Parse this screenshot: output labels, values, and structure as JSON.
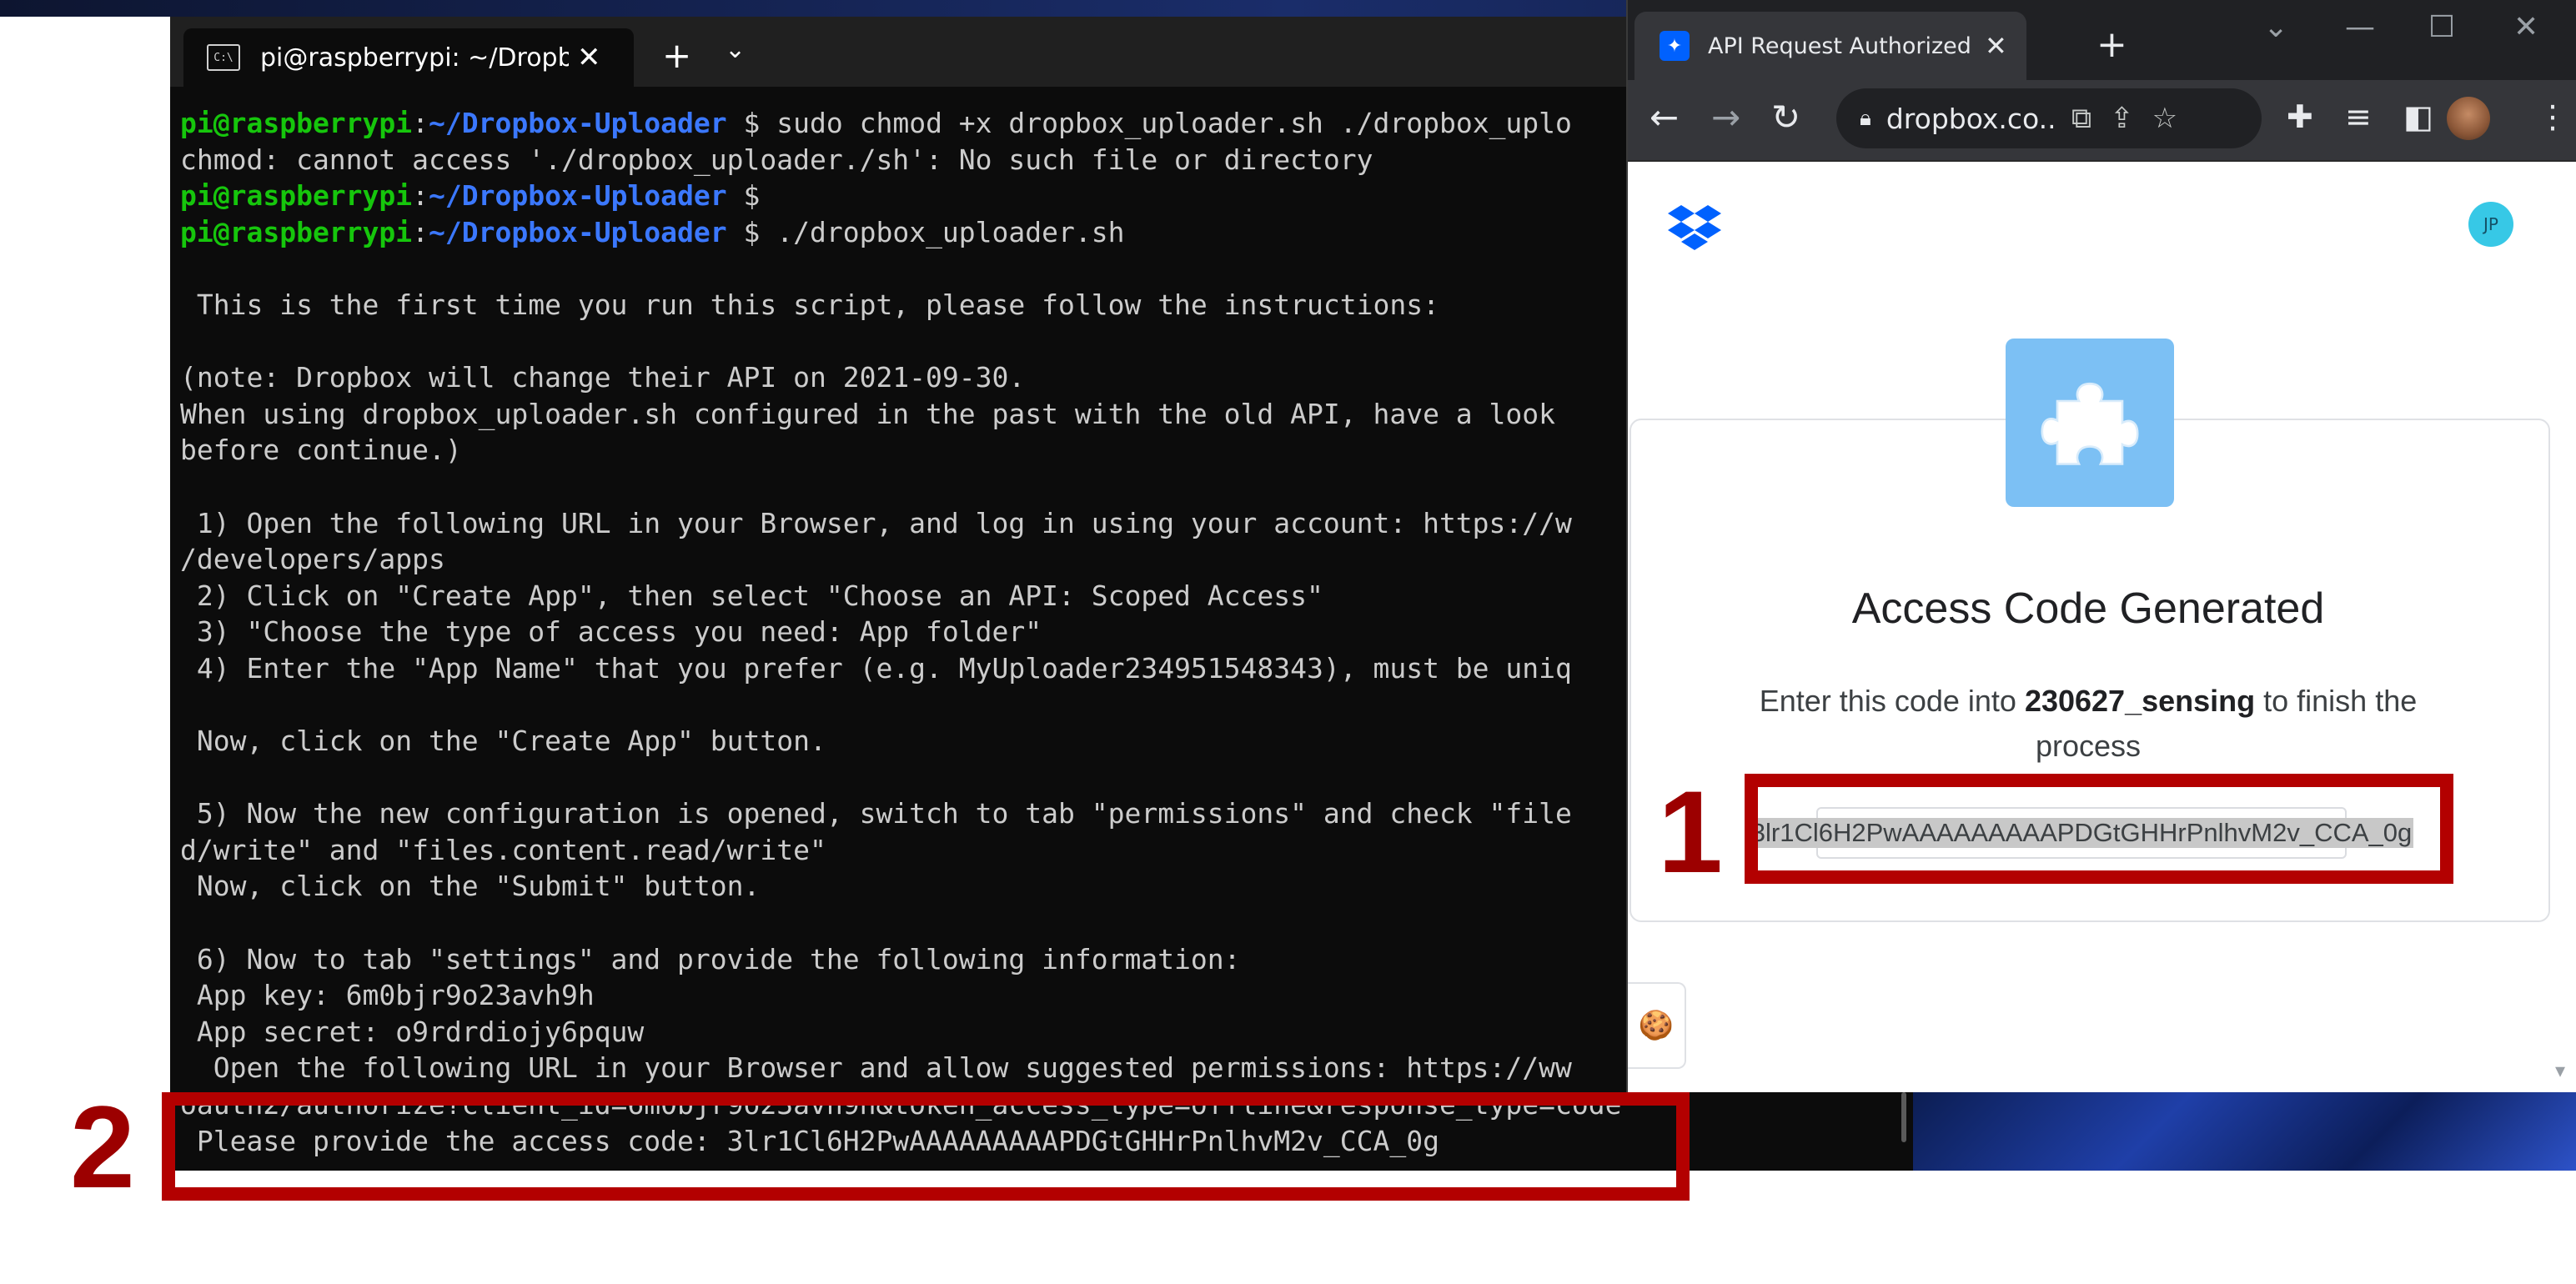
{
  "terminal": {
    "tab_title": "pi@raspberrypi: ~/Dropbox-U",
    "tab_icon": "terminal-icon",
    "lines": [
      {
        "type": "prompt",
        "user": "pi@raspberrypi",
        "path": "~/Dropbox-Uploader",
        "cmd": " sudo chmod +x dropbox_uploader.sh ./dropbox_uplo"
      },
      {
        "type": "text",
        "text": "chmod: cannot access './dropbox_uploader./sh': No such file or directory"
      },
      {
        "type": "prompt",
        "user": "pi@raspberrypi",
        "path": "~/Dropbox-Uploader",
        "cmd": ""
      },
      {
        "type": "prompt",
        "user": "pi@raspberrypi",
        "path": "~/Dropbox-Uploader",
        "cmd": " ./dropbox_uploader.sh"
      },
      {
        "type": "text",
        "text": ""
      },
      {
        "type": "text",
        "text": " This is the first time you run this script, please follow the instructions:"
      },
      {
        "type": "text",
        "text": ""
      },
      {
        "type": "text",
        "text": "(note: Dropbox will change their API on 2021-09-30."
      },
      {
        "type": "text",
        "text": "When using dropbox_uploader.sh configured in the past with the old API, have a look"
      },
      {
        "type": "text",
        "text": "before continue.)"
      },
      {
        "type": "text",
        "text": ""
      },
      {
        "type": "text",
        "text": " 1) Open the following URL in your Browser, and log in using your account: https://w"
      },
      {
        "type": "text",
        "text": "/developers/apps"
      },
      {
        "type": "text",
        "text": " 2) Click on \"Create App\", then select \"Choose an API: Scoped Access\""
      },
      {
        "type": "text",
        "text": " 3) \"Choose the type of access you need: App folder\""
      },
      {
        "type": "text",
        "text": " 4) Enter the \"App Name\" that you prefer (e.g. MyUploader234951548343), must be uniq"
      },
      {
        "type": "text",
        "text": ""
      },
      {
        "type": "text",
        "text": " Now, click on the \"Create App\" button."
      },
      {
        "type": "text",
        "text": ""
      },
      {
        "type": "text",
        "text": " 5) Now the new configuration is opened, switch to tab \"permissions\" and check \"file"
      },
      {
        "type": "text",
        "text": "d/write\" and \"files.content.read/write\""
      },
      {
        "type": "text",
        "text": " Now, click on the \"Submit\" button."
      },
      {
        "type": "text",
        "text": ""
      },
      {
        "type": "text",
        "text": " 6) Now to tab \"settings\" and provide the following information:"
      },
      {
        "type": "text",
        "text": " App key: 6m0bjr9o23avh9h"
      },
      {
        "type": "text",
        "text": " App secret: o9rdrdiojy6pquw"
      },
      {
        "type": "text",
        "text": "  Open the following URL in your Browser and allow suggested permissions: https://ww"
      },
      {
        "type": "text",
        "text": "oauth2/authorize?client_id=6m0bjr9o23avh9h&token_access_type=offline&response_type=code"
      },
      {
        "type": "text",
        "text": " Please provide the access code: 3lr1Cl6H2PwAAAAAAAAAPDGtGHHrPnlhvM2v_CCA_0g"
      }
    ]
  },
  "browser": {
    "tab_title": "API Request Authorized - Drop",
    "url": "dropbox.co...",
    "page": {
      "title": "Access Code Generated",
      "desc_prefix": "Enter this code into ",
      "app_name": "230627_sensing",
      "desc_suffix": " to finish the process",
      "access_code": "3lr1Cl6H2PwAAAAAAAAAPDGtGHHrPnlhvM2v_CCA_0g",
      "avatar_initials": "JP"
    }
  },
  "annotations": {
    "marker_1": "1",
    "marker_2": "2",
    "color": "#b30000"
  },
  "colors": {
    "terminal_bg": "#0c0c0c",
    "prompt_user": "#16c60c",
    "prompt_path": "#3b78ff",
    "dropbox_blue": "#0061fe",
    "avatar_bg": "#37c8e6"
  }
}
